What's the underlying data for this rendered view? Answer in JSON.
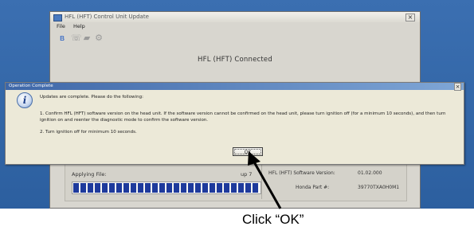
{
  "main_window": {
    "title": "HFL (HFT) Control Unit Update",
    "menu": [
      "File",
      "Help"
    ],
    "toolbar_icons": [
      "bluetooth-icon",
      "phone-icon",
      "car-icon",
      "settings-icon"
    ],
    "connection_status": "HFL (HFT) Connected",
    "applying_label": "Applying File:",
    "applying_count": "up 7",
    "progress_fraction": 1.0,
    "sw_version_label": "HFL (HFT) Software Version:",
    "sw_version_value": "01.02.000",
    "part_number_label": "Honda Part #:",
    "part_number_value": "39770TXA0H0M1"
  },
  "dialog": {
    "title": "Operation Complete",
    "close_label": "×",
    "message": "Updates are complete.  Please do the following:",
    "step1": "1. Confirm HFL (HFT) software version on the head unit.  If the software version cannot be confirmed on the head unit, please turn ignition off (for a minimum 10 seconds), and then turn ignition on and reenter the diagnostic mode to confirm the software version.",
    "step2": "2. Turn ignition off for minimum 10 seconds.",
    "ok_label": "OK",
    "icon": "info-icon"
  },
  "callout": {
    "text": "Click “OK”"
  },
  "colors": {
    "desktop": "#2c5f9f",
    "progress": "#1e3a9c",
    "dialog_title": "#3e67a8"
  }
}
